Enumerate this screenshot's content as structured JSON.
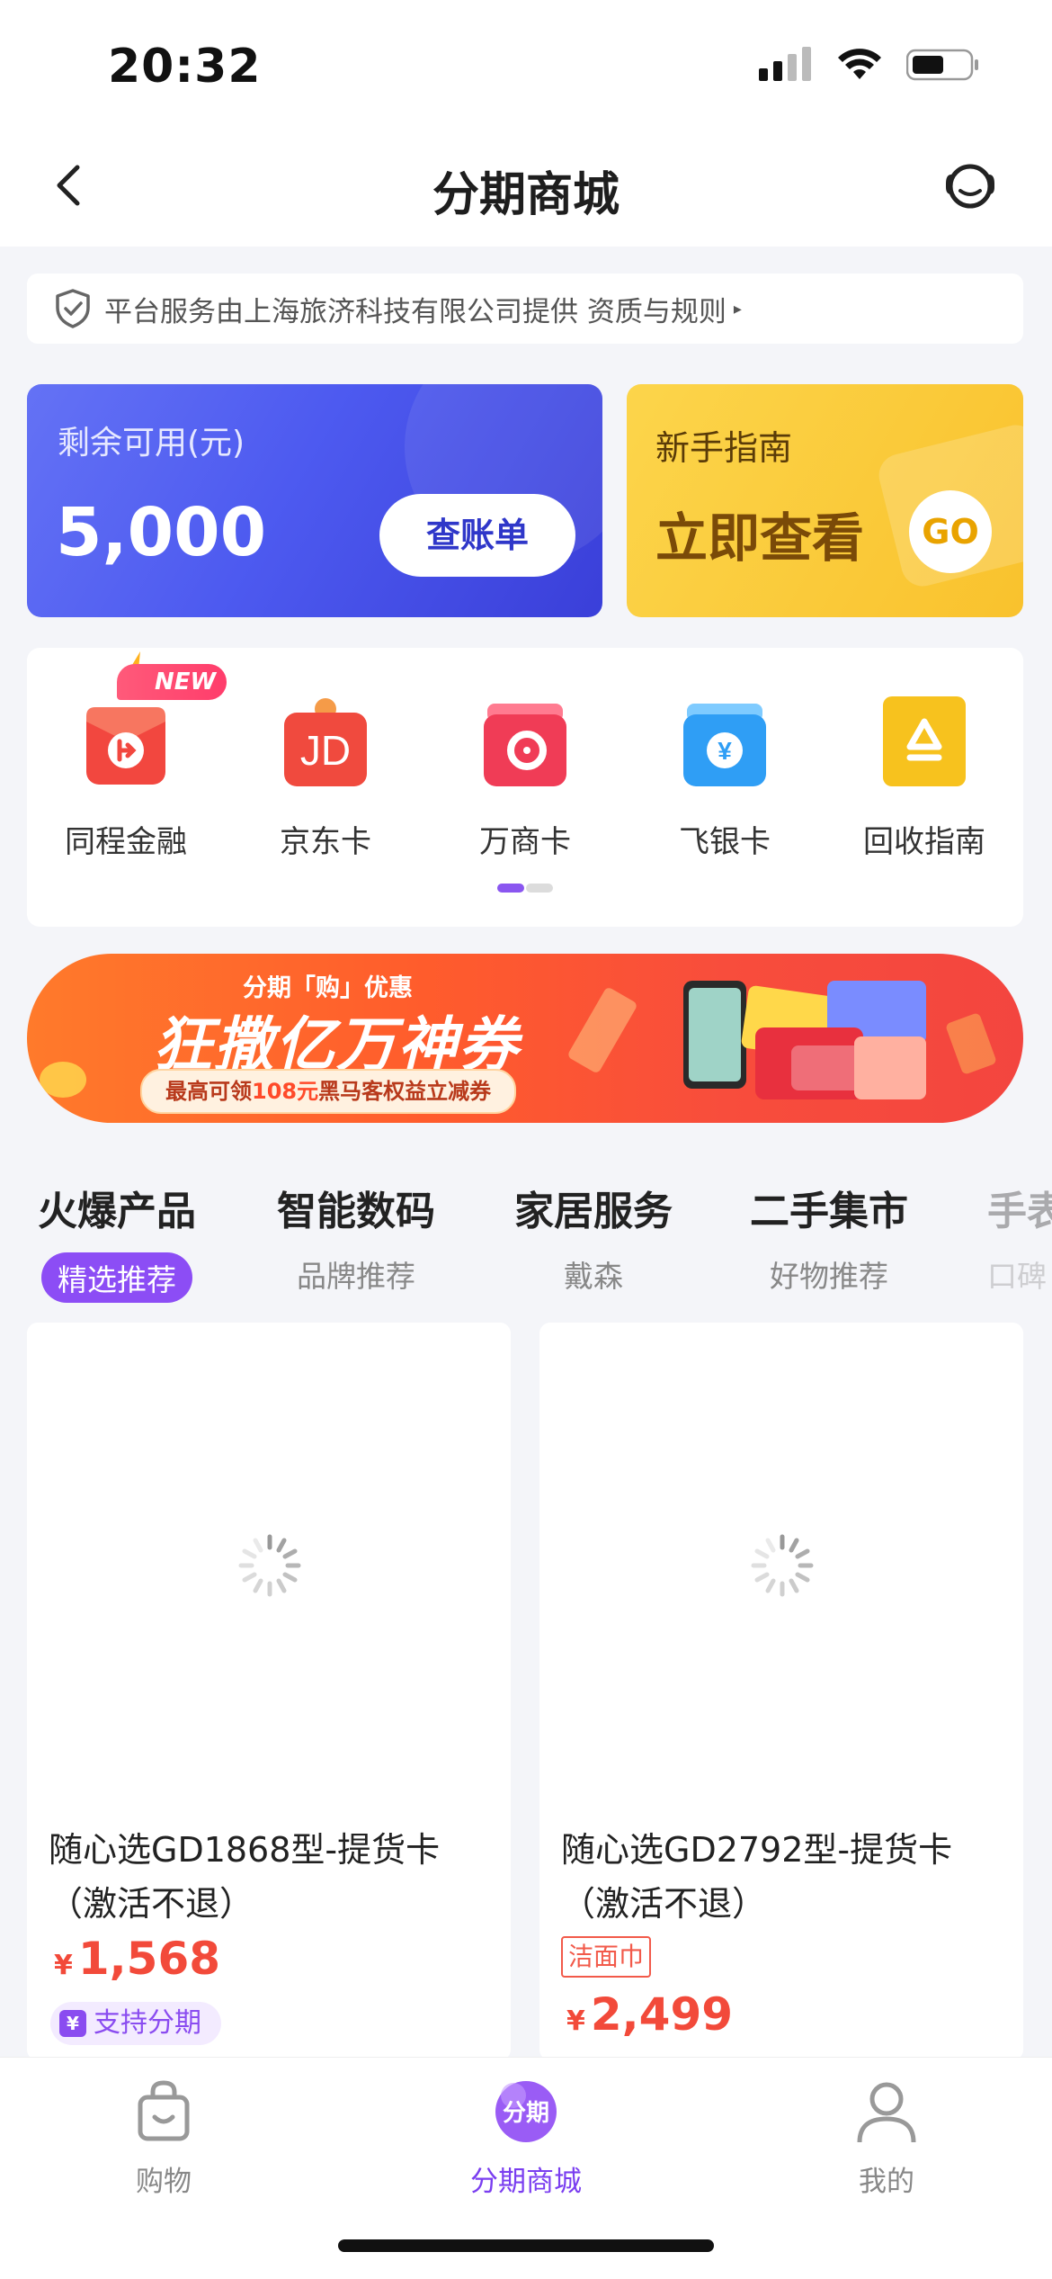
{
  "status_bar": {
    "time": "20:32"
  },
  "nav": {
    "title": "分期商城"
  },
  "notice": {
    "text": "平台服务由上海旅济科技有限公司提供 资质与规则",
    "arrow": "▸"
  },
  "credit": {
    "label": "剩余可用(元)",
    "amount": "5,000",
    "button": "查账单"
  },
  "guide": {
    "label": "新手指南",
    "cta": "立即查看",
    "go": "GO"
  },
  "shortcuts": {
    "new_badge": "NEW",
    "items": [
      {
        "label": "同程金融",
        "color": "#f2473f",
        "glyph": "ㄊ"
      },
      {
        "label": "京东卡",
        "color": "#f04a3e",
        "glyph": "JD"
      },
      {
        "label": "万商卡",
        "color": "#f03c56",
        "glyph": "ʘ"
      },
      {
        "label": "飞银卡",
        "color": "#2f9ef5",
        "glyph": "¥"
      },
      {
        "label": "回收指南",
        "color": "#f7c21e",
        "glyph": "♻"
      }
    ]
  },
  "promo": {
    "sub": "分期「购」优惠",
    "title": "狂撒亿万神券",
    "pill_prefix": "最高可领",
    "pill_highlight": "108元",
    "pill_suffix": "黑马客权益立减券"
  },
  "tabs": [
    {
      "name": "火爆产品",
      "sub": "精选推荐"
    },
    {
      "name": "智能数码",
      "sub": "品牌推荐"
    },
    {
      "name": "家居服务",
      "sub": "戴森"
    },
    {
      "name": "二手集市",
      "sub": "好物推荐"
    },
    {
      "name": "手表",
      "sub": "口碑"
    }
  ],
  "products": [
    {
      "name": "随心选GD1868型-提货卡（激活不退）",
      "currency": "¥",
      "price": "1,568",
      "tag": "支持分期",
      "tag_icon": "¥"
    },
    {
      "name": "随心选GD2792型-提货卡（激活不退）",
      "currency": "¥",
      "price": "2,499",
      "coupon": "洁面巾"
    }
  ],
  "tab_bar": {
    "items": [
      {
        "label": "购物"
      },
      {
        "label": "分期商城",
        "icon_text": "分期"
      },
      {
        "label": "我的"
      }
    ]
  },
  "colors": {
    "accent": "#8a4cf0",
    "price": "#f24a3a",
    "credit_card": "#4d5af0",
    "guide_card": "#f9c22d"
  }
}
